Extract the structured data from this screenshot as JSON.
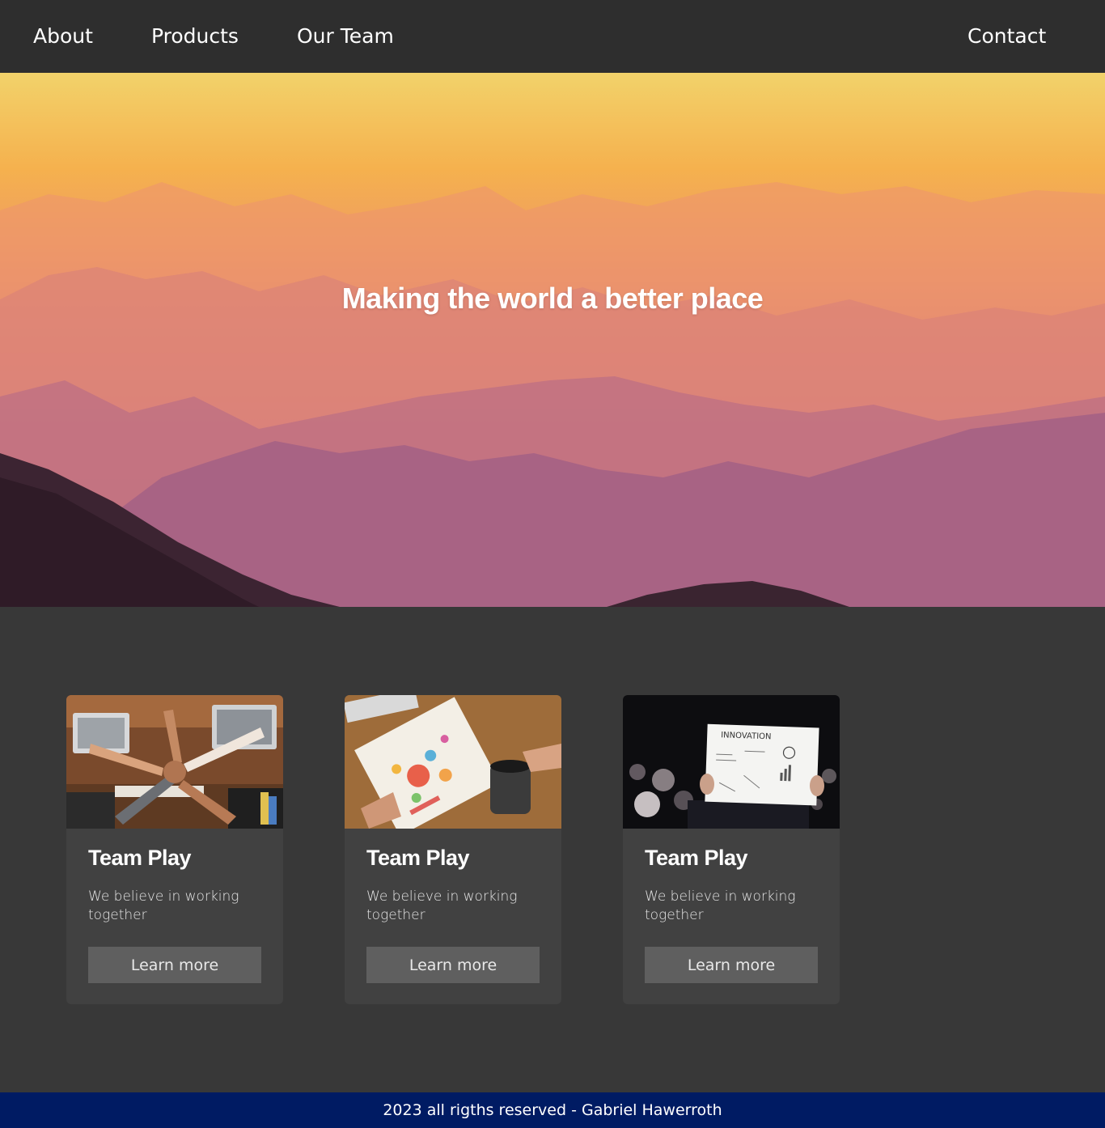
{
  "nav": {
    "about": "About",
    "products": "Products",
    "our_team": "Our Team",
    "contact": "Contact"
  },
  "hero": {
    "title": "Making the world a better place"
  },
  "cards": [
    {
      "title": "Team Play",
      "text": "We believe in working together",
      "button": "Learn more",
      "image": "team-hands-photo"
    },
    {
      "title": "Team Play",
      "text": "We believe in working together",
      "button": "Learn more",
      "image": "notebook-coffee-photo"
    },
    {
      "title": "Team Play",
      "text": "We believe in working together",
      "button": "Learn more",
      "image": "innovation-sheet-photo",
      "image_text": "INNOVATION"
    }
  ],
  "footer": {
    "text": "2023 all rigths reserved - Gabriel Hawerroth"
  },
  "colors": {
    "nav_bg": "#2e2e2e",
    "page_bg": "#383838",
    "card_bg": "#414141",
    "button_bg": "#5f5f5f",
    "footer_bg": "#001b63"
  }
}
